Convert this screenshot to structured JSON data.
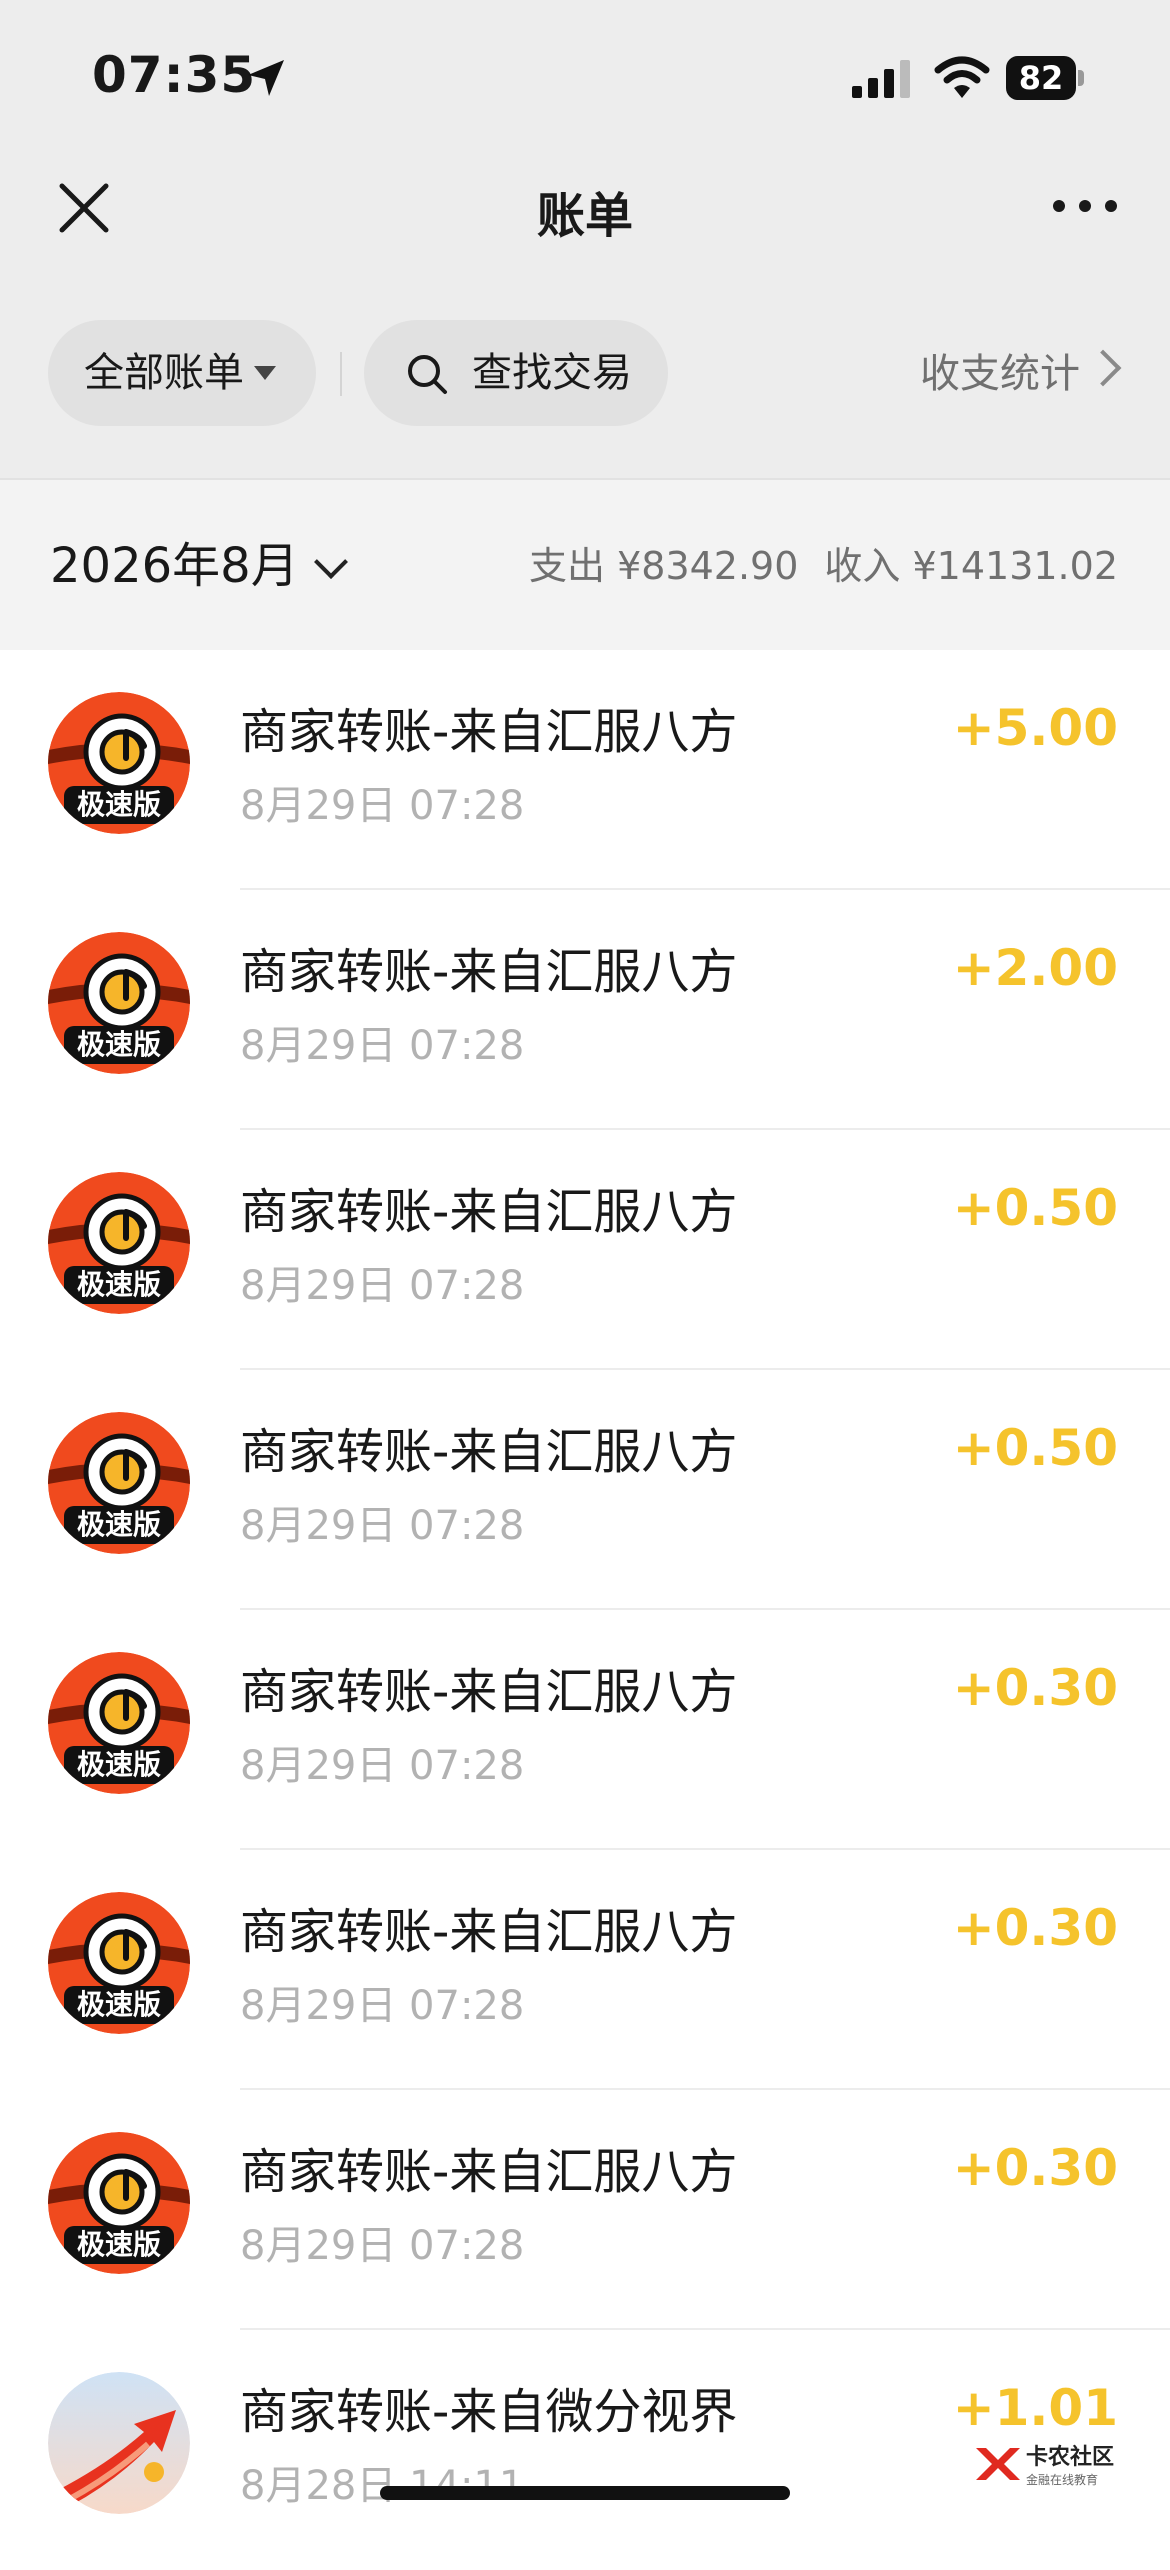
{
  "status_bar": {
    "time": "07:35",
    "battery": "82"
  },
  "nav": {
    "title": "账单"
  },
  "filters": {
    "all_bills": "全部账单",
    "search": "查找交易",
    "stats": "收支统计"
  },
  "summary": {
    "month": "2026年8月",
    "expense": "支出 ¥8342.90",
    "income": "收入 ¥14131.02"
  },
  "transactions": [
    {
      "title": "商家转账-来自汇服八方",
      "date": "8月29日 07:28",
      "amount": "+5.00",
      "avatar_badge": "极速版"
    },
    {
      "title": "商家转账-来自汇服八方",
      "date": "8月29日 07:28",
      "amount": "+2.00",
      "avatar_badge": "极速版"
    },
    {
      "title": "商家转账-来自汇服八方",
      "date": "8月29日 07:28",
      "amount": "+0.50",
      "avatar_badge": "极速版"
    },
    {
      "title": "商家转账-来自汇服八方",
      "date": "8月29日 07:28",
      "amount": "+0.50",
      "avatar_badge": "极速版"
    },
    {
      "title": "商家转账-来自汇服八方",
      "date": "8月29日 07:28",
      "amount": "+0.30",
      "avatar_badge": "极速版"
    },
    {
      "title": "商家转账-来自汇服八方",
      "date": "8月29日 07:28",
      "amount": "+0.30",
      "avatar_badge": "极速版"
    },
    {
      "title": "商家转账-来自汇服八方",
      "date": "8月29日 07:28",
      "amount": "+0.30",
      "avatar_badge": "极速版"
    },
    {
      "title": "商家转账-来自微分视界",
      "date": "8月28日 14:11",
      "amount": "+1.01",
      "avatar_badge": ""
    }
  ],
  "watermark": {
    "name": "卡农社区",
    "tagline": "金融在线教育"
  },
  "colors": {
    "income": "#f5c32c",
    "background_top": "#ededed",
    "chip": "#e1e1e1"
  },
  "icons": [
    "location-arrow-icon",
    "signal-icon",
    "wifi-icon",
    "battery-icon",
    "close-icon",
    "more-icon",
    "dropdown-triangle-icon",
    "search-icon",
    "chevron-right-icon",
    "chevron-down-icon"
  ]
}
